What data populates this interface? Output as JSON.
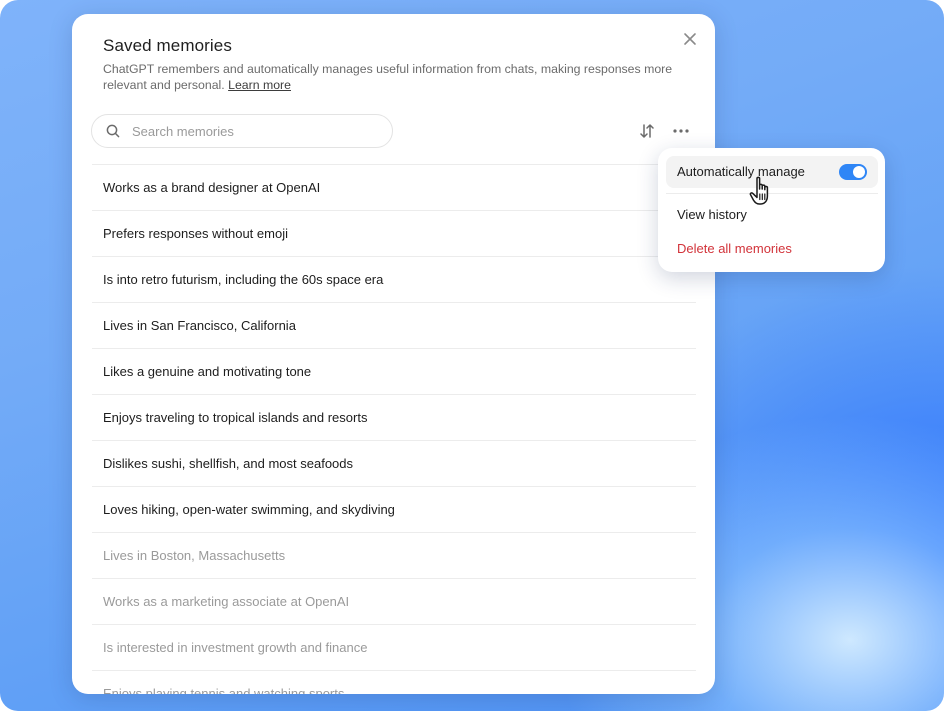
{
  "dialog": {
    "title": "Saved memories",
    "description": "ChatGPT remembers and automatically manages useful information from chats, making responses more relevant and personal.",
    "learn_more_label": "Learn more"
  },
  "search": {
    "placeholder": "Search memories",
    "value": ""
  },
  "toolbar": {
    "sort_icon": "sort-arrows-icon",
    "more_icon": "ellipsis-icon",
    "close_icon": "close-icon"
  },
  "memories": [
    {
      "text": "Works as a brand designer at OpenAI",
      "dimmed": false
    },
    {
      "text": "Prefers responses without emoji",
      "dimmed": false
    },
    {
      "text": "Is into retro futurism, including the 60s space era",
      "dimmed": false
    },
    {
      "text": "Lives in San Francisco, California",
      "dimmed": false
    },
    {
      "text": "Likes a genuine and motivating tone",
      "dimmed": false
    },
    {
      "text": "Enjoys traveling to tropical islands and resorts",
      "dimmed": false
    },
    {
      "text": "Dislikes sushi, shellfish, and most seafoods",
      "dimmed": false
    },
    {
      "text": "Loves hiking, open-water swimming, and skydiving",
      "dimmed": false
    },
    {
      "text": "Lives in Boston, Massachusetts",
      "dimmed": true
    },
    {
      "text": "Works as a marketing associate at OpenAI",
      "dimmed": true
    },
    {
      "text": "Is interested in investment growth and finance",
      "dimmed": true
    },
    {
      "text": "Enjoys playing tennis and watching sports",
      "dimmed": true
    }
  ],
  "menu": {
    "auto_manage_label": "Automatically manage",
    "auto_manage_enabled": true,
    "view_history_label": "View history",
    "delete_all_label": "Delete all memories"
  },
  "colors": {
    "toggle_on": "#2f86f6",
    "danger": "#d2333a",
    "background_blue": "#6aa6f7"
  }
}
